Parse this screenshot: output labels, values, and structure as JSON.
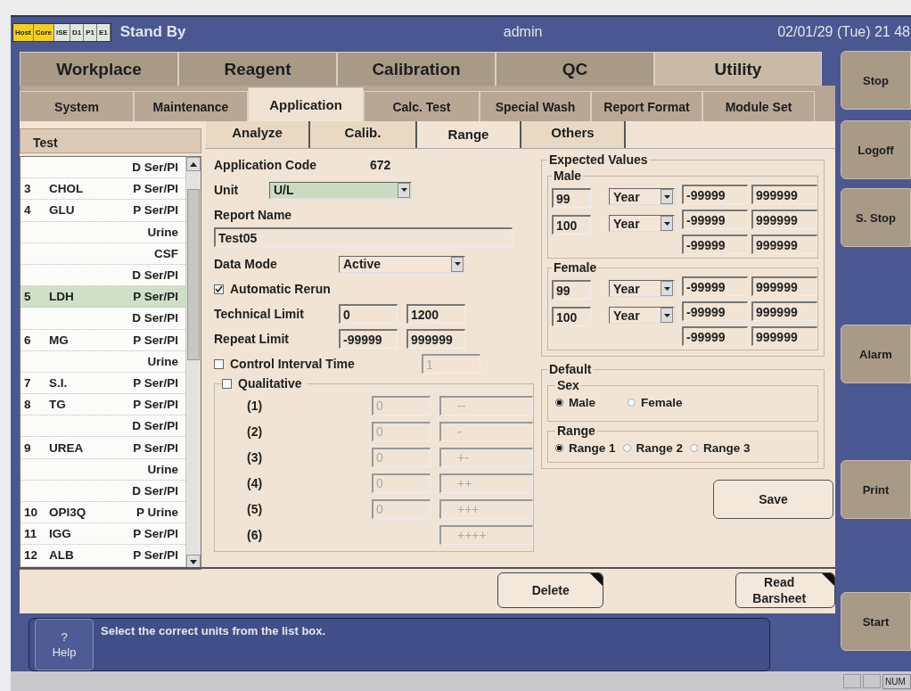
{
  "header": {
    "modules": [
      {
        "label": "Host",
        "color": "#f4cf1e"
      },
      {
        "label": "Core",
        "color": "#f4cf1e"
      },
      {
        "label": "ISE",
        "color": "#dfe6dc"
      },
      {
        "label": "D1",
        "color": "#dfe6dc"
      },
      {
        "label": "P1",
        "color": "#dfe6dc"
      },
      {
        "label": "E1",
        "color": "#dfe6dc"
      }
    ],
    "status": "Stand By",
    "user": "admin",
    "datetime": "02/01/29 (Tue) 21 48"
  },
  "main_tabs": [
    {
      "label": "Workplace",
      "selected": false
    },
    {
      "label": "Reagent",
      "selected": false
    },
    {
      "label": "Calibration",
      "selected": false
    },
    {
      "label": "QC",
      "selected": false
    },
    {
      "label": "Utility",
      "selected": true
    }
  ],
  "sub_tabs": [
    {
      "label": "System",
      "selected": false
    },
    {
      "label": "Maintenance",
      "selected": false
    },
    {
      "label": "Application",
      "selected": true
    },
    {
      "label": "Calc. Test",
      "selected": false
    },
    {
      "label": "Special Wash",
      "selected": false
    },
    {
      "label": "Report Format",
      "selected": false
    },
    {
      "label": "Module Set",
      "selected": false
    }
  ],
  "test_list": {
    "heading": "Test",
    "rows": [
      {
        "number": "",
        "name": "",
        "type": "D Ser/Pl",
        "selected": false
      },
      {
        "number": "3",
        "name": "CHOL",
        "type": "P Ser/Pl",
        "selected": false
      },
      {
        "number": "4",
        "name": "GLU",
        "type": "P Ser/Pl",
        "selected": false
      },
      {
        "number": "",
        "name": "",
        "type": "Urine",
        "selected": false
      },
      {
        "number": "",
        "name": "",
        "type": "CSF",
        "selected": false
      },
      {
        "number": "",
        "name": "",
        "type": "D Ser/Pl",
        "selected": false
      },
      {
        "number": "5",
        "name": "LDH",
        "type": "P Ser/Pl",
        "selected": true
      },
      {
        "number": "",
        "name": "",
        "type": "D Ser/Pl",
        "selected": false
      },
      {
        "number": "6",
        "name": "MG",
        "type": "P Ser/Pl",
        "selected": false
      },
      {
        "number": "",
        "name": "",
        "type": "Urine",
        "selected": false
      },
      {
        "number": "7",
        "name": "S.I.",
        "type": "P Ser/Pl",
        "selected": false
      },
      {
        "number": "8",
        "name": "TG",
        "type": "P Ser/Pl",
        "selected": false
      },
      {
        "number": "",
        "name": "",
        "type": "D Ser/Pl",
        "selected": false
      },
      {
        "number": "9",
        "name": "UREA",
        "type": "P Ser/Pl",
        "selected": false
      },
      {
        "number": "",
        "name": "",
        "type": "Urine",
        "selected": false
      },
      {
        "number": "",
        "name": "",
        "type": "D Ser/Pl",
        "selected": false
      },
      {
        "number": "10",
        "name": "OPI3Q",
        "type": "P Urine",
        "selected": false
      },
      {
        "number": "11",
        "name": "IGG",
        "type": "P Ser/Pl",
        "selected": false
      },
      {
        "number": "12",
        "name": "ALB",
        "type": "P Ser/Pl",
        "selected": false
      }
    ]
  },
  "detail_tabs": [
    {
      "label": "Analyze",
      "selected": false
    },
    {
      "label": "Calib.",
      "selected": false
    },
    {
      "label": "Range",
      "selected": true
    },
    {
      "label": "Others",
      "selected": false
    }
  ],
  "form": {
    "application_code": {
      "label": "Application Code",
      "value": "672"
    },
    "unit": {
      "label": "Unit",
      "value": "U/L"
    },
    "report_name": {
      "label": "Report Name",
      "value": "Test05"
    },
    "data_mode": {
      "label": "Data Mode",
      "value": "Active"
    },
    "automatic_rerun": {
      "label": "Automatic Rerun",
      "checked": true
    },
    "limits": [
      {
        "label": "Technical Limit",
        "low": "0",
        "high": "1200"
      },
      {
        "label": "Repeat Limit",
        "low": "-99999",
        "high": "999999"
      }
    ],
    "control_interval_time": {
      "label": "Control Interval Time",
      "checked": false,
      "value": "1"
    },
    "qualitative": {
      "label": "Qualitative",
      "checked": false,
      "rows": [
        {
          "label": "(1)",
          "value": "0",
          "symbol": "--"
        },
        {
          "label": "(2)",
          "value": "0",
          "symbol": "-"
        },
        {
          "label": "(3)",
          "value": "0",
          "symbol": "+-"
        },
        {
          "label": "(4)",
          "value": "0",
          "symbol": "++"
        },
        {
          "label": "(5)",
          "value": "0",
          "symbol": "+++"
        },
        {
          "label": "(6)",
          "symbol": "++++"
        }
      ]
    }
  },
  "expected_values": {
    "title": "Expected Values",
    "groups": [
      {
        "label": "Male",
        "ages": [
          {
            "value": "99",
            "unit": "Year"
          },
          {
            "value": "100",
            "unit": "Year"
          }
        ],
        "ranges": [
          {
            "low": "-99999",
            "high": "999999"
          },
          {
            "low": "-99999",
            "high": "999999"
          },
          {
            "low": "-99999",
            "high": "999999"
          }
        ]
      },
      {
        "label": "Female",
        "ages": [
          {
            "value": "99",
            "unit": "Year"
          },
          {
            "value": "100",
            "unit": "Year"
          }
        ],
        "ranges": [
          {
            "low": "-99999",
            "high": "999999"
          },
          {
            "low": "-99999",
            "high": "999999"
          },
          {
            "low": "-99999",
            "high": "999999"
          }
        ]
      }
    ]
  },
  "default": {
    "title": "Default",
    "groups": [
      {
        "label": "Sex",
        "options": [
          {
            "label": "Male",
            "selected": true
          },
          {
            "label": "Female",
            "selected": false
          }
        ]
      },
      {
        "label": "Range",
        "options": [
          {
            "label": "Range 1",
            "selected": true
          },
          {
            "label": "Range 2",
            "selected": false
          },
          {
            "label": "Range 3",
            "selected": false
          }
        ]
      }
    ]
  },
  "save_button": "Save",
  "bottom_buttons": [
    "Delete",
    "Read Barsheet"
  ],
  "side_buttons": [
    "Stop",
    "Logoff",
    "S. Stop",
    "Alarm",
    "Print",
    "Start"
  ],
  "help_button": {
    "icon": "?",
    "label": "Help"
  },
  "message": "Select the correct units from the list box.",
  "status_bar": {
    "indicator": "NUM"
  }
}
